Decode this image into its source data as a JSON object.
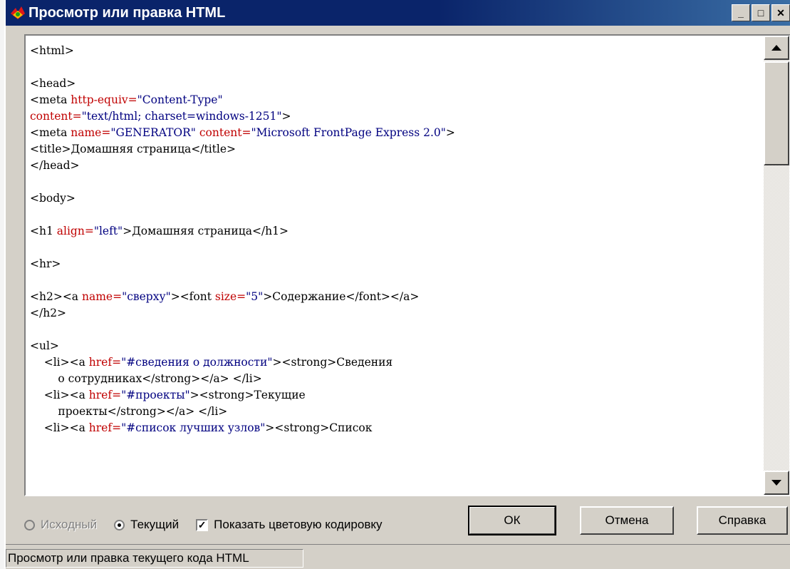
{
  "window": {
    "title": "Просмотр или правка HTML",
    "controls": {
      "minimize": "_",
      "maximize": "□",
      "close": "✕"
    },
    "icon": "frontpage-app-icon"
  },
  "editor": {
    "lines": [
      [
        [
          "tag",
          "<html>"
        ]
      ],
      [],
      [
        [
          "tag",
          "<head>"
        ]
      ],
      [
        [
          "tag",
          "<meta "
        ],
        [
          "attr",
          "http-equiv="
        ],
        [
          "val",
          "\"Content-Type\""
        ]
      ],
      [
        [
          "attr",
          "content="
        ],
        [
          "val",
          "\"text/html; charset=windows-1251\""
        ],
        [
          "tag",
          ">"
        ]
      ],
      [
        [
          "tag",
          "<meta "
        ],
        [
          "attr",
          "name="
        ],
        [
          "val",
          "\"GENERATOR\""
        ],
        [
          "tag",
          " "
        ],
        [
          "attr",
          "content="
        ],
        [
          "val",
          "\"Microsoft FrontPage Express 2.0\""
        ],
        [
          "tag",
          ">"
        ]
      ],
      [
        [
          "tag",
          "<title>"
        ],
        [
          "txt",
          "Домашняя страница"
        ],
        [
          "tag",
          "</title>"
        ]
      ],
      [
        [
          "tag",
          "</head>"
        ]
      ],
      [],
      [
        [
          "tag",
          "<body>"
        ]
      ],
      [],
      [
        [
          "tag",
          "<h1 "
        ],
        [
          "attr",
          "align="
        ],
        [
          "val",
          "\"left\""
        ],
        [
          "tag",
          ">"
        ],
        [
          "txt",
          "Домашняя страница"
        ],
        [
          "tag",
          "</h1>"
        ]
      ],
      [],
      [
        [
          "tag",
          "<hr>"
        ]
      ],
      [],
      [
        [
          "tag",
          "<h2><a "
        ],
        [
          "attr",
          "name="
        ],
        [
          "val",
          "\"сверху\""
        ],
        [
          "tag",
          "><font "
        ],
        [
          "attr",
          "size="
        ],
        [
          "val",
          "\"5\""
        ],
        [
          "tag",
          ">"
        ],
        [
          "txt",
          "Содержание"
        ],
        [
          "tag",
          "</font></a>"
        ]
      ],
      [
        [
          "tag",
          "</h2>"
        ]
      ],
      [],
      [
        [
          "tag",
          "<ul>"
        ]
      ],
      [
        [
          "txt",
          "    "
        ],
        [
          "tag",
          "<li><a "
        ],
        [
          "attr",
          "href="
        ],
        [
          "val",
          "\"#сведения о должности\""
        ],
        [
          "tag",
          "><strong>"
        ],
        [
          "txt",
          "Сведения"
        ]
      ],
      [
        [
          "txt",
          "        о сотрудниках"
        ],
        [
          "tag",
          "</strong></a> </li>"
        ]
      ],
      [
        [
          "txt",
          "    "
        ],
        [
          "tag",
          "<li><a "
        ],
        [
          "attr",
          "href="
        ],
        [
          "val",
          "\"#проекты\""
        ],
        [
          "tag",
          "><strong>"
        ],
        [
          "txt",
          "Текущие"
        ]
      ],
      [
        [
          "txt",
          "        проекты"
        ],
        [
          "tag",
          "</strong></a> </li>"
        ]
      ],
      [
        [
          "txt",
          "    "
        ],
        [
          "tag",
          "<li><a "
        ],
        [
          "attr",
          "href="
        ],
        [
          "val",
          "\"#список лучших узлов\""
        ],
        [
          "tag",
          "><strong>"
        ],
        [
          "txt",
          "Список"
        ]
      ]
    ]
  },
  "options": {
    "source_label": "Исходный",
    "current_label": "Текущий",
    "color_coding_label": "Показать цветовую кодировку",
    "selected": "current",
    "color_coding_checked": true
  },
  "buttons": {
    "ok": "ОК",
    "cancel": "Отмена",
    "help": "Справка"
  },
  "status": {
    "text": "Просмотр или правка текущего кода HTML"
  },
  "colors": {
    "title_bar": "#0a246a",
    "attr": "#c00000",
    "value": "#000080",
    "face": "#d4d0c8"
  }
}
